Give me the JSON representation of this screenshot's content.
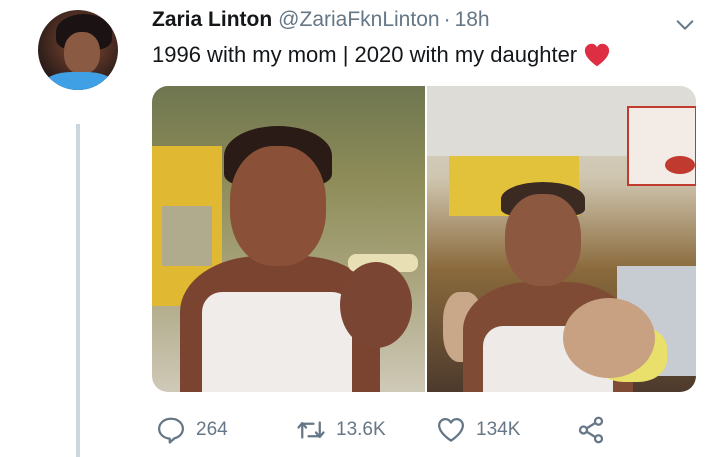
{
  "author": {
    "name": "Zaria Linton",
    "handle": "@ZariaFknLinton",
    "separator": "·",
    "time": "18h"
  },
  "tweet": {
    "text": "1996 with my mom | 2020 with my daughter",
    "emoji": "red-heart"
  },
  "media": {
    "left_photo": "1996 photo",
    "right_photo": "2020 photo"
  },
  "actions": {
    "reply_count": "264",
    "retweet_count": "13.6K",
    "like_count": "134K"
  },
  "colors": {
    "text": "#14171a",
    "secondary": "#657786",
    "thread_line": "#ccd6dd",
    "heart": "#e0245e"
  }
}
